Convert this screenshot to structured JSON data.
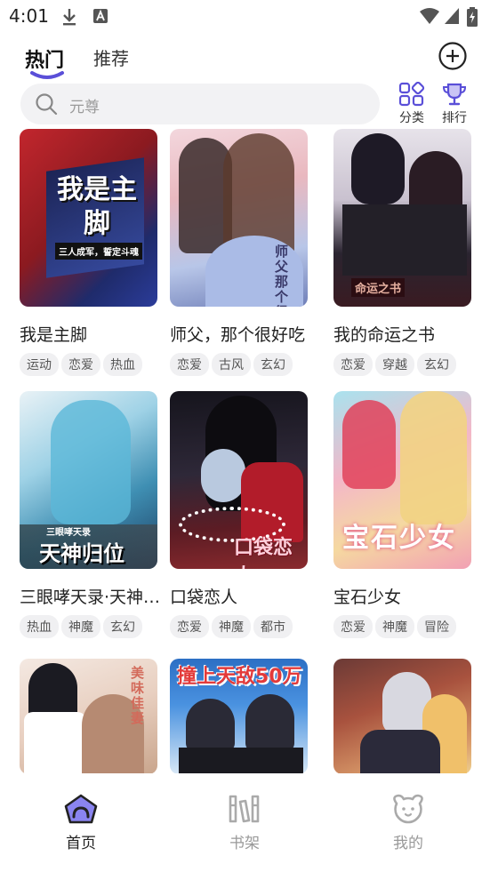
{
  "status_bar": {
    "time": "4:01"
  },
  "tabs": [
    {
      "label": "热门",
      "active": true
    },
    {
      "label": "推荐",
      "active": false
    }
  ],
  "search": {
    "placeholder": "元尊"
  },
  "side_buttons": {
    "category": "分类",
    "ranking": "排行"
  },
  "comics": [
    {
      "title": "我是主脚",
      "tags": [
        "运动",
        "恋爱",
        "热血"
      ],
      "cover_text": "我是主脚",
      "cover_subtext": "三人成军，誓定斗魂"
    },
    {
      "title": "师父，那个很好吃",
      "tags": [
        "恋爱",
        "古风",
        "玄幻"
      ],
      "cover_text": "师父那个很好吃"
    },
    {
      "title": "我的命运之书",
      "tags": [
        "恋爱",
        "穿越",
        "玄幻"
      ],
      "cover_text": "命运之书"
    },
    {
      "title": "三眼哮天录·天神归位",
      "tags": [
        "热血",
        "神魔",
        "玄幻"
      ],
      "cover_text": "天神归位",
      "cover_subtext": "三眼哮天录"
    },
    {
      "title": "口袋恋人",
      "tags": [
        "恋爱",
        "神魔",
        "都市"
      ],
      "cover_text": "口袋恋人"
    },
    {
      "title": "宝石少女",
      "tags": [
        "恋爱",
        "神魔",
        "冒险"
      ],
      "cover_text": "宝石少女"
    },
    {
      "title": "",
      "tags": [],
      "cover_text": "美味佳妻"
    },
    {
      "title": "",
      "tags": [],
      "cover_text": "撞上天敌50万"
    },
    {
      "title": "",
      "tags": [],
      "cover_text": ""
    }
  ],
  "bottom_nav": [
    {
      "label": "首页",
      "icon": "home-icon",
      "active": true
    },
    {
      "label": "书架",
      "icon": "bookshelf-icon",
      "active": false
    },
    {
      "label": "我的",
      "icon": "profile-icon",
      "active": false
    }
  ],
  "colors": {
    "accent": "#5a4fd8",
    "text": "#222222",
    "tag_bg": "#f0f0f2"
  }
}
